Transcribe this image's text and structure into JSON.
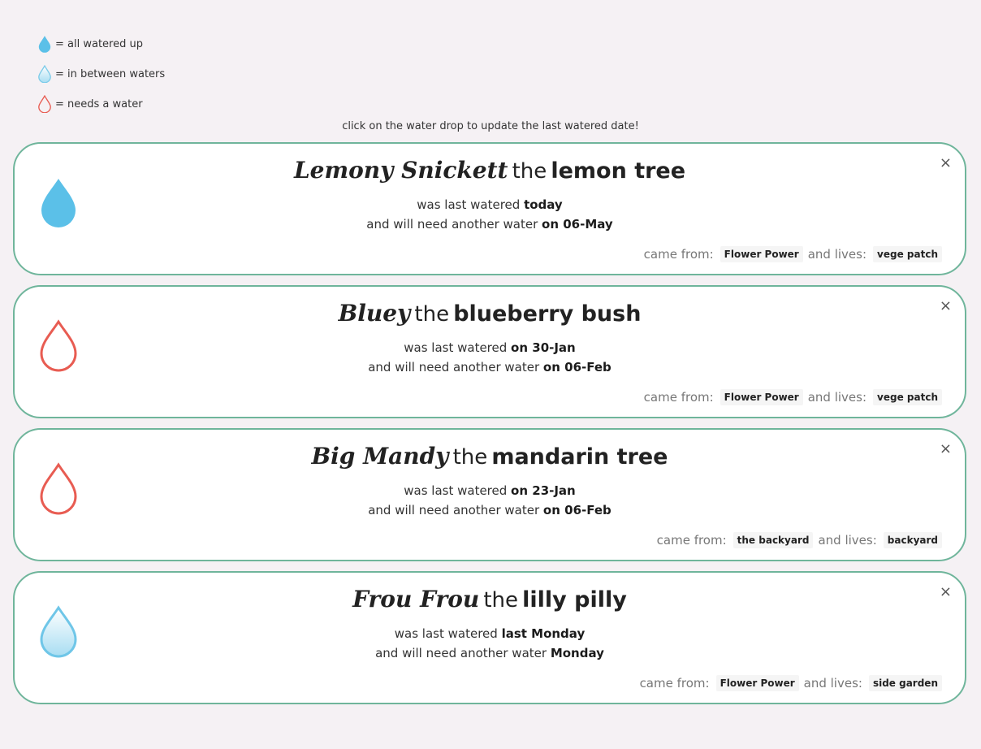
{
  "legend": [
    {
      "icon": "drop-full-icon",
      "label": "= all watered up"
    },
    {
      "icon": "drop-half-icon",
      "label": "= in between waters"
    },
    {
      "icon": "drop-empty-icon",
      "label": "= needs a water"
    }
  ],
  "hint": "click on the water drop to update the last watered date!",
  "colors": {
    "full": "#5bc0e8",
    "empty": "#e85c52",
    "border": "#6fb59b"
  },
  "common": {
    "the": "the",
    "last_watered_prefix": "was last watered ",
    "next_water_prefix": "and will need another water ",
    "came_from_label": "came from:",
    "lives_label": "and lives:",
    "close": "×"
  },
  "plants": [
    {
      "status": "full",
      "nickname": "Lemony Snickett",
      "species": "lemon tree",
      "last": "today",
      "next": "on 06-May",
      "from": "Flower Power",
      "lives": "vege patch"
    },
    {
      "status": "empty",
      "nickname": "Bluey",
      "species": "blueberry bush",
      "last": "on 30-Jan",
      "next": "on 06-Feb",
      "from": "Flower Power",
      "lives": "vege patch"
    },
    {
      "status": "empty",
      "nickname": "Big Mandy",
      "species": "mandarin tree",
      "last": "on 23-Jan",
      "next": "on 06-Feb",
      "from": "the backyard",
      "lives": "backyard"
    },
    {
      "status": "half",
      "nickname": "Frou Frou",
      "species": "lilly pilly",
      "last": "last Monday",
      "next": "Monday",
      "from": "Flower Power",
      "lives": "side garden"
    }
  ]
}
